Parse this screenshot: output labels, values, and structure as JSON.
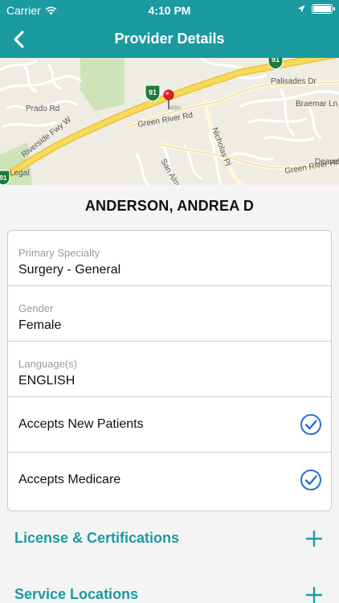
{
  "status_bar": {
    "carrier": "Carrier",
    "time": "4:10 PM"
  },
  "nav": {
    "title": "Provider Details"
  },
  "map": {
    "labels": {
      "palisades": "Palisades Dr",
      "prado": "Prado Rd",
      "green_river_1": "Green River Rd",
      "riverside": "Riverside Fwy W",
      "braemar": "Braemar Ln",
      "nicholas": "Nicholas Pl",
      "san_alm": "San Alm",
      "green_river_2": "Green River Rd",
      "deave": "Deave",
      "legal": "Legal",
      "shield_91_a": "91",
      "shield_91_b": "91",
      "shield_91_c": "91"
    }
  },
  "provider": {
    "name": "ANDERSON, ANDREA D"
  },
  "details": {
    "specialty_label": "Primary Specialty",
    "specialty_value": "Surgery - General",
    "gender_label": "Gender",
    "gender_value": "Female",
    "language_label": "Language(s)",
    "language_value": "ENGLISH",
    "new_patients_label": "Accepts New Patients",
    "medicare_label": "Accepts Medicare"
  },
  "sections": {
    "license": "License & Certifications",
    "locations": "Service Locations"
  },
  "colors": {
    "accent": "#1b9aa0",
    "check": "#2a6fd6"
  }
}
